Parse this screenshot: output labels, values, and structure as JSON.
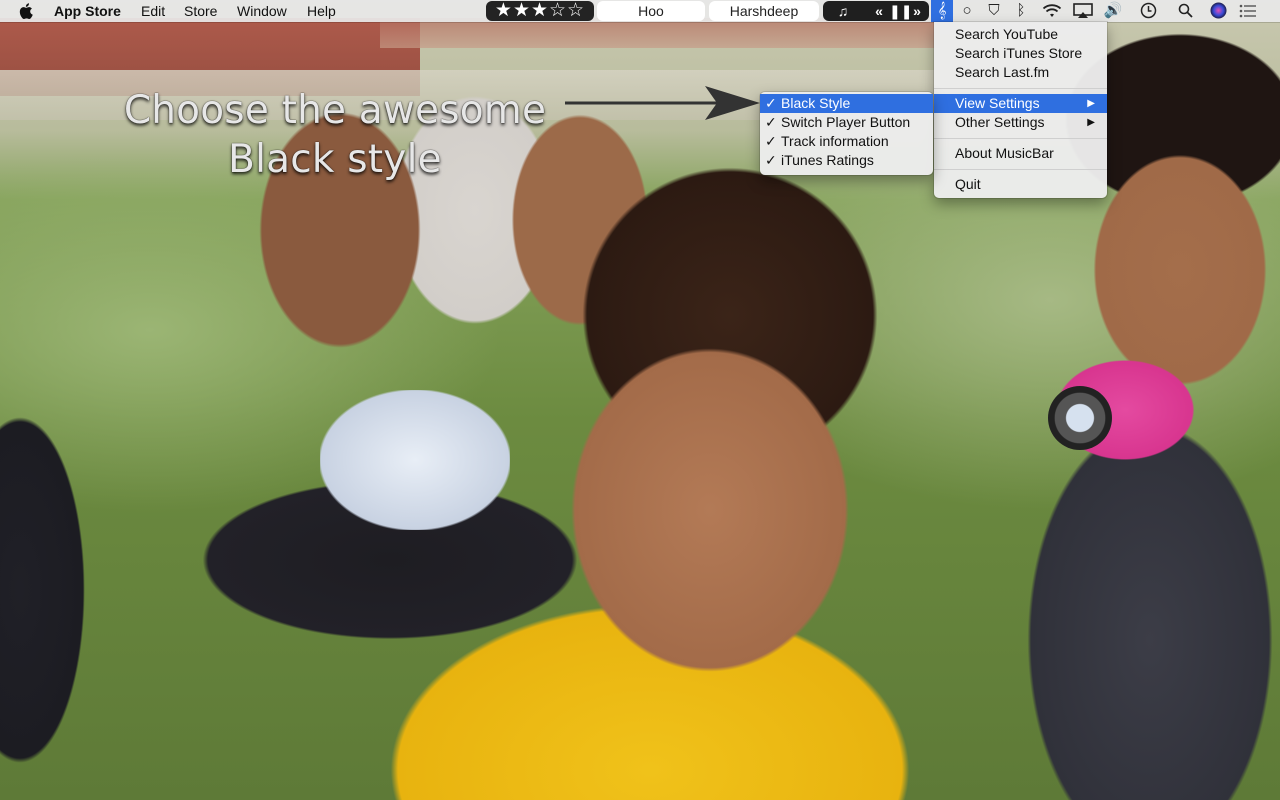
{
  "menubar": {
    "app_name": "App Store",
    "menus": [
      "Edit",
      "Store",
      "Window",
      "Help"
    ],
    "rating_stars": "★★★☆☆",
    "track_name": "Hoo",
    "artist_name": "Harshdeep",
    "controls": {
      "itunes": "♫",
      "prev": "«",
      "pause": "❚❚",
      "next": "»"
    },
    "status_icons": [
      "musicbar-icon",
      "circle-icon",
      "shield-icon",
      "bluetooth-icon",
      "wifi-icon",
      "airplay-icon",
      "volume-icon",
      "clock-icon",
      "spotlight-icon",
      "siri-icon",
      "notification-center-icon"
    ]
  },
  "caption": {
    "line1": "Choose the awesome",
    "line2": "Black style"
  },
  "main_menu": {
    "items": [
      {
        "label": "Search YouTube"
      },
      {
        "label": "Search iTunes Store"
      },
      {
        "label": "Search Last.fm"
      },
      {
        "label": "View Settings"
      },
      {
        "label": "Other Settings"
      },
      {
        "label": "About MusicBar"
      },
      {
        "label": "Quit"
      }
    ]
  },
  "sub_menu": {
    "items": [
      {
        "label": "Black Style",
        "check": "✓"
      },
      {
        "label": "Switch Player Button",
        "check": "✓"
      },
      {
        "label": "Track information",
        "check": "✓"
      },
      {
        "label": "iTunes Ratings",
        "check": "✓"
      }
    ]
  },
  "colors": {
    "highlight": "#2f6fe0",
    "menubar_bg": "#e8e8e8",
    "dark_pill": "#232323"
  }
}
